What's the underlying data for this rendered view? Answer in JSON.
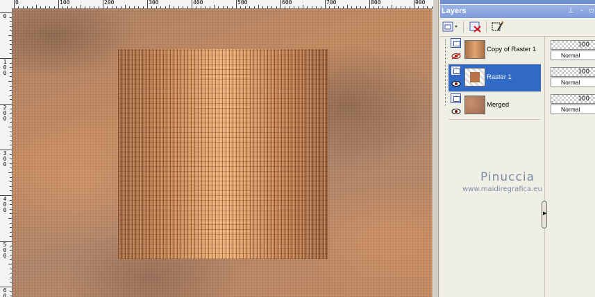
{
  "rulers": {
    "top_labels": [
      "0",
      "100",
      "200",
      "300",
      "400",
      "500",
      "600",
      "700",
      "800",
      "900"
    ],
    "left_labels": [
      "0",
      "100",
      "200",
      "300",
      "400",
      "500",
      "600"
    ]
  },
  "layers_panel": {
    "title": "Layers",
    "layers": [
      {
        "name": "Copy of Raster 1",
        "opacity": "100",
        "blend_mode": "Normal",
        "visible": false,
        "selected": false,
        "thumb_color": "#c08055"
      },
      {
        "name": "Raster 1",
        "opacity": "100",
        "blend_mode": "Normal",
        "visible": true,
        "selected": true,
        "thumb_color": "#b87448"
      },
      {
        "name": "Merged",
        "opacity": "100",
        "blend_mode": "Normal",
        "visible": true,
        "selected": false,
        "thumb_color": "#b27f5f"
      }
    ]
  },
  "watermark": {
    "name": "Pinuccia",
    "url": "www.maidiregrafica.eu"
  },
  "colors": {
    "selection": "#316ac5",
    "titlebar": "#8aa4e0"
  }
}
